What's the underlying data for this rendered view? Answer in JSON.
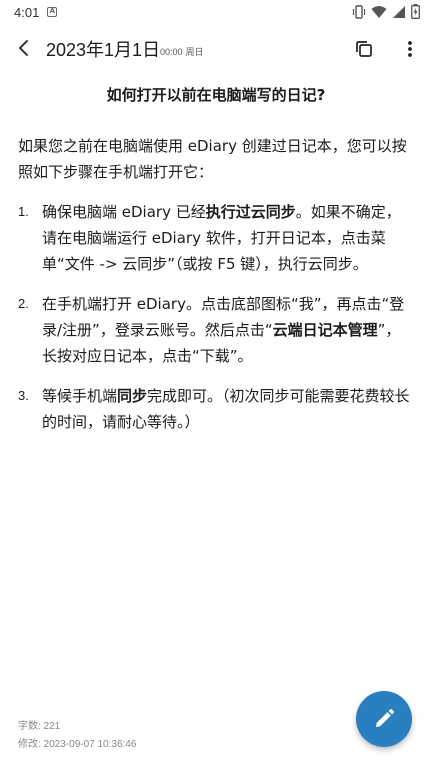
{
  "status_bar": {
    "time": "4:01",
    "notification_icon": "a-notification-icon",
    "icons": [
      "vibrate-icon",
      "wifi-icon",
      "signal-icon",
      "battery-charging-icon"
    ]
  },
  "app_bar": {
    "date": "2023年1月1日",
    "time": "00:00",
    "weekday": "周日"
  },
  "note": {
    "title": "如何打开以前在电脑端写的日记?",
    "intro": "如果您之前在电脑端使用 eDiary 创建过日记本，您可以按照如下步骤在手机端打开它：",
    "steps": [
      {
        "num": "1.",
        "parts": [
          "确保电脑端 eDiary 已经",
          "执行过云同步",
          "。如果不确定，请在电脑端运行 eDiary 软件，打开日记本，点击菜单“文件 -> 云同步”（或按 F5 键），执行云同步。"
        ]
      },
      {
        "num": "2.",
        "parts": [
          "在手机端打开 eDiary。点击底部图标“我”，再点击“登录/注册”，登录云账号。然后点击“",
          "云端日记本管理",
          "”，长按对应日记本，点击“下载”。"
        ]
      },
      {
        "num": "3.",
        "parts": [
          "等候手机端",
          "同步",
          "完成即可。（初次同步可能需要花费较长的时间，请耐心等待。）"
        ]
      }
    ]
  },
  "footer": {
    "word_count": "字数: 221",
    "modified": "修改: 2023-09-07 10:36:46"
  },
  "colors": {
    "fab": "#2a7fc0",
    "text": "#1c1c1c",
    "meta": "#888888"
  }
}
